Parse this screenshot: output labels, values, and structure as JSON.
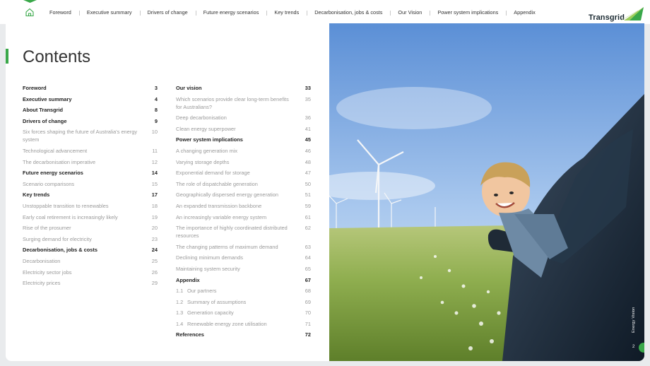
{
  "nav": {
    "items": [
      "Foreword",
      "Executive summary",
      "Drivers of change",
      "Future energy scenarios",
      "Key trends",
      "Decarbonisation, jobs & costs",
      "Our Vision",
      "Power system implications",
      "Appendix"
    ]
  },
  "brand": {
    "name": "Transgrid",
    "accent": "#3aa84a"
  },
  "page": {
    "title": "Contents",
    "side_label": "Energy Vision",
    "number": "2"
  },
  "toc": {
    "col1": [
      {
        "label": "Foreword",
        "page": "3",
        "type": "main"
      },
      {
        "label": "Executive summary",
        "page": "4",
        "type": "main"
      },
      {
        "label": "About Transgrid",
        "page": "8",
        "type": "main"
      },
      {
        "label": "Drivers of change",
        "page": "9",
        "type": "main"
      },
      {
        "label": "Six forces shaping the future of Australia's energy system",
        "page": "10",
        "type": "sub"
      },
      {
        "label": "Technological advancement",
        "page": "11",
        "type": "sub"
      },
      {
        "label": "The decarbonisation imperative",
        "page": "12",
        "type": "sub"
      },
      {
        "label": "Future energy scenarios",
        "page": "14",
        "type": "main"
      },
      {
        "label": "Scenario comparisons",
        "page": "15",
        "type": "sub"
      },
      {
        "label": "Key trends",
        "page": "17",
        "type": "main"
      },
      {
        "label": "Unstoppable transition to renewables",
        "page": "18",
        "type": "sub"
      },
      {
        "label": "Early coal retirement is increasingly likely",
        "page": "19",
        "type": "sub"
      },
      {
        "label": "Rise of the prosumer",
        "page": "20",
        "type": "sub"
      },
      {
        "label": "Surging demand for electricity",
        "page": "23",
        "type": "sub"
      },
      {
        "label": "Decarbonisation, jobs & costs",
        "page": "24",
        "type": "main"
      },
      {
        "label": "Decarbonisation",
        "page": "25",
        "type": "sub"
      },
      {
        "label": "Electricity sector jobs",
        "page": "26",
        "type": "sub"
      },
      {
        "label": "Electricity prices",
        "page": "29",
        "type": "sub"
      }
    ],
    "col2": [
      {
        "label": "Our vision",
        "page": "33",
        "type": "main"
      },
      {
        "label": "Which scenarios provide clear long-term benefits for Australians?",
        "page": "35",
        "type": "sub"
      },
      {
        "label": "Deep decarbonisation",
        "page": "36",
        "type": "sub"
      },
      {
        "label": "Clean energy superpower",
        "page": "41",
        "type": "sub"
      },
      {
        "label": "Power system implications",
        "page": "45",
        "type": "main"
      },
      {
        "label": "A changing generation mix",
        "page": "46",
        "type": "sub"
      },
      {
        "label": "Varying storage depths",
        "page": "48",
        "type": "sub"
      },
      {
        "label": "Exponential demand for storage",
        "page": "47",
        "type": "sub"
      },
      {
        "label": "The role of dispatchable generation",
        "page": "50",
        "type": "sub"
      },
      {
        "label": "Geographically dispersed energy generation",
        "page": "51",
        "type": "sub"
      },
      {
        "label": "An expanded transmission backbone",
        "page": "59",
        "type": "sub"
      },
      {
        "label": "An increasingly variable energy system",
        "page": "61",
        "type": "sub"
      },
      {
        "label": "The importance of highly coordinated distributed resources",
        "page": "62",
        "type": "sub"
      },
      {
        "label": "The changing patterns of maximum demand",
        "page": "63",
        "type": "sub"
      },
      {
        "label": "Declining minimum demands",
        "page": "64",
        "type": "sub"
      },
      {
        "label": "Maintaining system security",
        "page": "65",
        "type": "sub"
      },
      {
        "label": "Appendix",
        "page": "67",
        "type": "main"
      },
      {
        "label": "Our partners",
        "num": "1.1",
        "page": "68",
        "type": "sub"
      },
      {
        "label": "Summary of assumptions",
        "num": "1.2",
        "page": "69",
        "type": "sub"
      },
      {
        "label": "Generation capacity",
        "num": "1.3",
        "page": "70",
        "type": "sub"
      },
      {
        "label": "Renewable energy zone utilisation",
        "num": "1.4",
        "page": "71",
        "type": "sub"
      },
      {
        "label": "References",
        "page": "72",
        "type": "main"
      }
    ]
  }
}
